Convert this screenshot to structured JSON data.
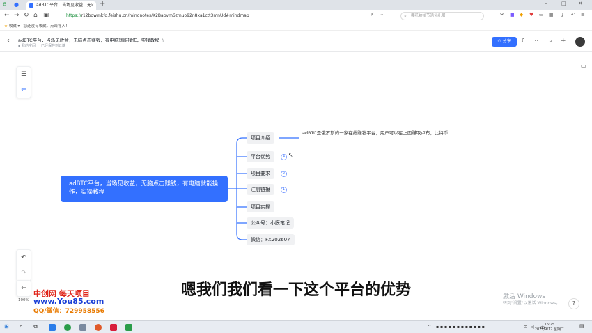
{
  "browser": {
    "tab_title": "adBTC平台，当场见收益，无...",
    "url_secure": "https://",
    "url_rest": "r12bowmkfq.feishu.cn/mindnotes/K2Babvm6zmuo92n8xa1ctt3mnUd#mindmap",
    "search_placeholder": "哪吒被拍节活化礼服",
    "bookmark_1": "收藏",
    "bookmark_2": "您还没有收藏，点击导入！"
  },
  "header": {
    "title": "adBTC平台，当场见收益，无脑点击赚钱，有电脑就能操作，实操教程 ☆",
    "space": "我的空间",
    "save_status": "已经保存到云端",
    "share_label": "分享"
  },
  "mindmap": {
    "root": "adBTC平台，当场见收益，无脑点击赚钱，有电脑就能操作，实操教程",
    "children": [
      {
        "label": "项目介绍"
      },
      {
        "label": "平台优势",
        "badge": "4"
      },
      {
        "label": "项目要求",
        "badge": "2"
      },
      {
        "label": "注册链接",
        "badge": "1"
      },
      {
        "label": "项目实操"
      },
      {
        "label": "公众号：小膜笔记"
      },
      {
        "label": "微信：FX202607"
      }
    ],
    "leaf": "adBTC是俄罗斯的一家在线赚钱平台，用户可以在上面赚取卢布，比特币"
  },
  "zoom": "100%",
  "subtitle": "嗯我们我们看一下这个平台的优势",
  "watermark": {
    "line1": "中创网 每天项目",
    "line2": "www.You85.com",
    "line3": "QQ/微信：729958556"
  },
  "activation": {
    "line1": "激活 Windows",
    "line2": "转到\"设置\"以激活 Windows。"
  },
  "taskbar": {
    "time": "16:25",
    "date": "2023/9/12 星期二",
    "lang": "中"
  },
  "colors": {
    "accent": "#3370ff",
    "node_bg": "#f0f1f3"
  }
}
